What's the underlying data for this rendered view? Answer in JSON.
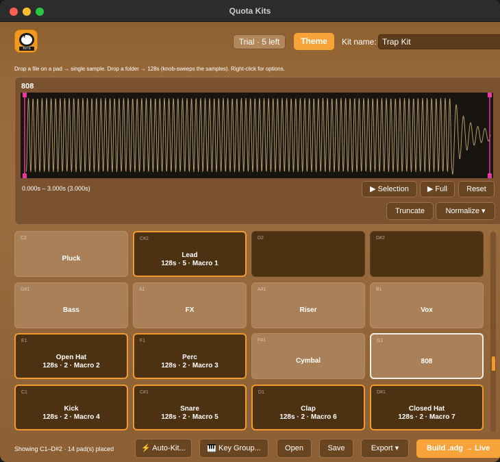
{
  "window": {
    "title": "Quota Kits"
  },
  "header": {
    "logo_text": "KITS",
    "trial_label": "Trial · 5 left",
    "theme_label": "Theme",
    "kitname_label": "Kit name:",
    "kitname_value": "Trap Kit"
  },
  "hint": "Drop a file on a pad → single sample.   Drop a folder → 128s (knob-sweeps the samples).   Right-click for options.",
  "waveform": {
    "title": "808",
    "range_text": "0.000s – 3.000s   (3.000s)",
    "selection_start": 0.0,
    "selection_end": 1.0,
    "wave_color": "#b69a6c",
    "marker_color": "#e8379e",
    "buttons": {
      "selection": "▶ Selection",
      "full": "▶ Full",
      "reset": "Reset",
      "truncate": "Truncate",
      "normalize": "Normalize ▾"
    }
  },
  "pads": [
    {
      "note": "C2",
      "name": "Pluck",
      "sub": "",
      "state": "light"
    },
    {
      "note": "C#2",
      "name": "Lead",
      "sub": "128s · 5 · Macro 1",
      "state": "assigned"
    },
    {
      "note": "D2",
      "name": "",
      "sub": "",
      "state": "dark"
    },
    {
      "note": "D#2",
      "name": "",
      "sub": "",
      "state": "dark"
    },
    {
      "note": "G#1",
      "name": "Bass",
      "sub": "",
      "state": "light"
    },
    {
      "note": "A1",
      "name": "FX",
      "sub": "",
      "state": "light"
    },
    {
      "note": "A#1",
      "name": "Riser",
      "sub": "",
      "state": "light"
    },
    {
      "note": "B1",
      "name": "Vox",
      "sub": "",
      "state": "light"
    },
    {
      "note": "E1",
      "name": "Open Hat",
      "sub": "128s · 2 · Macro 2",
      "state": "assigned"
    },
    {
      "note": "F1",
      "name": "Perc",
      "sub": "128s · 2 · Macro 3",
      "state": "assigned"
    },
    {
      "note": "F#1",
      "name": "Cymbal",
      "sub": "",
      "state": "light"
    },
    {
      "note": "G1",
      "name": "808",
      "sub": "",
      "state": "selected"
    },
    {
      "note": "C1",
      "name": "Kick",
      "sub": "128s · 2 · Macro 4",
      "state": "assigned"
    },
    {
      "note": "C#1",
      "name": "Snare",
      "sub": "128s · 2 · Macro 5",
      "state": "assigned"
    },
    {
      "note": "D1",
      "name": "Clap",
      "sub": "128s · 2 · Macro 6",
      "state": "assigned"
    },
    {
      "note": "D#1",
      "name": "Closed Hat",
      "sub": "128s · 2 · Macro 7",
      "state": "assigned"
    }
  ],
  "bottom": {
    "status": "Showing C1–D#2  ·  14 pad(s) placed",
    "autokit": "⚡ Auto-Kit...",
    "keygroup": "🎹 Key Group...",
    "open": "Open",
    "save": "Save",
    "export": "Export ▾",
    "build": "Build .adg → Live"
  },
  "colors": {
    "accent": "#f29a2e",
    "bg": "#98693a"
  }
}
